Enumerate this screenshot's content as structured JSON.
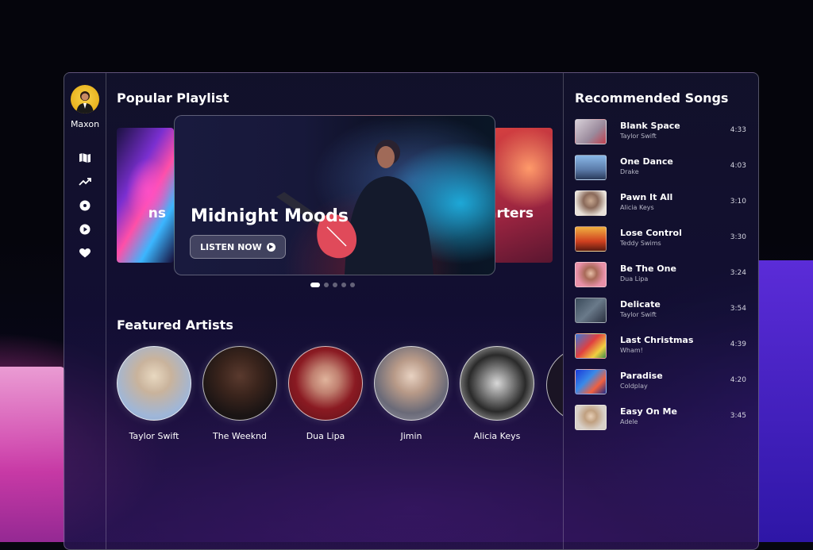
{
  "user": {
    "name": "Maxon"
  },
  "nav": {
    "icons": [
      "map-icon",
      "trending-icon",
      "disc-icon",
      "play-icon",
      "heart-icon"
    ]
  },
  "playlist": {
    "heading": "Popular Playlist",
    "left_title_partial": "ns",
    "right_title_partial": "arters",
    "featured_title": "Midnight Moods",
    "button_label": "LISTEN NOW",
    "dots_total": 5,
    "dots_active": 0
  },
  "artists": {
    "heading": "Featured Artists",
    "items": [
      {
        "name": "Taylor Swift"
      },
      {
        "name": "The Weeknd"
      },
      {
        "name": "Dua Lipa"
      },
      {
        "name": "Jimin"
      },
      {
        "name": "Alicia Keys"
      }
    ]
  },
  "songs": {
    "heading": "Recommended Songs",
    "items": [
      {
        "title": "Blank Space",
        "artist": "Taylor Swift",
        "duration": "4:33"
      },
      {
        "title": "One Dance",
        "artist": "Drake",
        "duration": "4:03"
      },
      {
        "title": "Pawn It All",
        "artist": "Alicia Keys",
        "duration": "3:10"
      },
      {
        "title": "Lose Control",
        "artist": "Teddy Swims",
        "duration": "3:30"
      },
      {
        "title": "Be The One",
        "artist": "Dua Lipa",
        "duration": "3:24"
      },
      {
        "title": "Delicate",
        "artist": "Taylor Swift",
        "duration": "3:54"
      },
      {
        "title": "Last Christmas",
        "artist": "Wham!",
        "duration": "4:39"
      },
      {
        "title": "Paradise",
        "artist": "Coldplay",
        "duration": "4:20"
      },
      {
        "title": "Easy On Me",
        "artist": "Adele",
        "duration": "3:45"
      }
    ]
  },
  "colors": {
    "accent": "#5b2cd8",
    "pink": "#ec40b4",
    "avatar_bg": "#f0c030"
  }
}
